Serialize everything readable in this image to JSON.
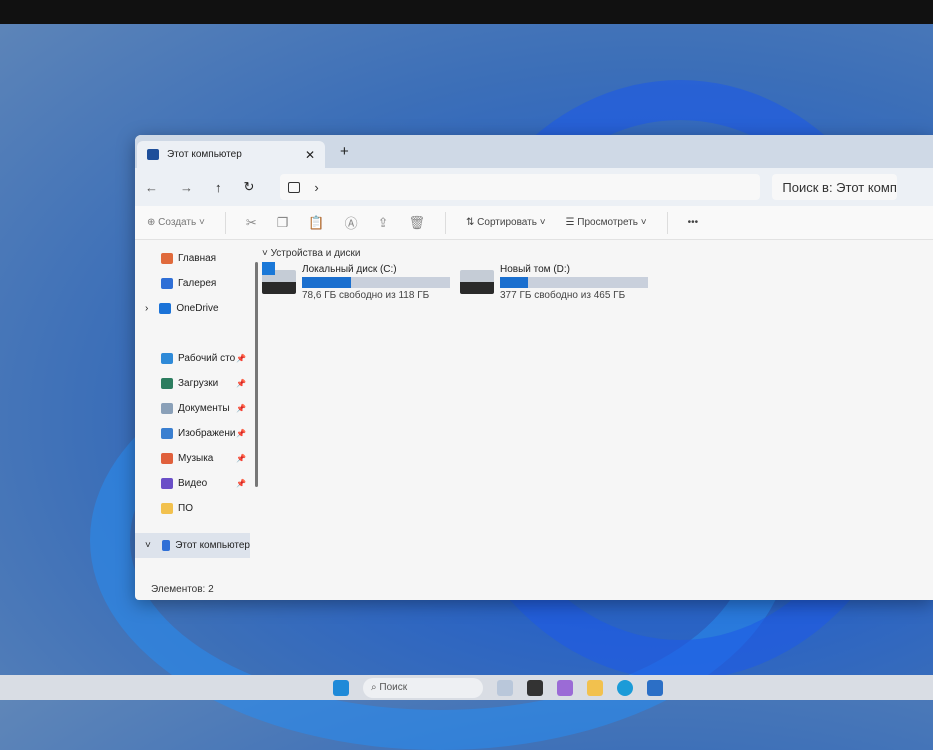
{
  "window": {
    "tab_title": "Этот компьютер",
    "close": "✕",
    "new_tab": "+"
  },
  "nav": {
    "back": "←",
    "forward": "→",
    "up": "↑",
    "refresh": "↻",
    "crumb_sep": "›",
    "search_placeholder": "Поиск в: Этот компьютер"
  },
  "toolbar": {
    "create": "Создать",
    "sort": "Сортировать",
    "view": "Просмотреть",
    "more": "•••"
  },
  "sidebar": {
    "items": [
      {
        "label": "Главная",
        "icon": "home-icon",
        "color": "#e06a3c"
      },
      {
        "label": "Галерея",
        "icon": "gallery-icon",
        "color": "#2f6fd6"
      },
      {
        "label": "OneDrive",
        "icon": "cloud-icon",
        "color": "#1b73d8"
      },
      {
        "label": "Рабочий сто",
        "icon": "desktop-icon",
        "color": "#2f8ad8",
        "pinned": true
      },
      {
        "label": "Загрузки",
        "icon": "download-icon",
        "color": "#2c7d5f",
        "pinned": true
      },
      {
        "label": "Документы",
        "icon": "documents-icon",
        "color": "#8aa0b8",
        "pinned": true
      },
      {
        "label": "Изображени",
        "icon": "pictures-icon",
        "color": "#3a7fd0",
        "pinned": true
      },
      {
        "label": "Музыка",
        "icon": "music-icon",
        "color": "#e0603c",
        "pinned": true
      },
      {
        "label": "Видео",
        "icon": "video-icon",
        "color": "#6a4fc7",
        "pinned": true
      },
      {
        "label": "ПО",
        "icon": "folder-icon",
        "color": "#f2c14e"
      },
      {
        "label": "Этот компьютер",
        "icon": "computer-icon",
        "color": "#2f6fd6"
      }
    ],
    "pin": "📌"
  },
  "main": {
    "group": "Устройства и диски",
    "drives": [
      {
        "name": "Локальный диск (C:)",
        "info": "78,6 ГБ свободно из 118 ГБ",
        "used_fraction": 0.33
      },
      {
        "name": "Новый том (D:)",
        "info": "377 ГБ свободно из 465 ГБ",
        "used_fraction": 0.19
      }
    ]
  },
  "status": "Элементов: 2",
  "taskbar": {
    "search": "Поиск"
  }
}
